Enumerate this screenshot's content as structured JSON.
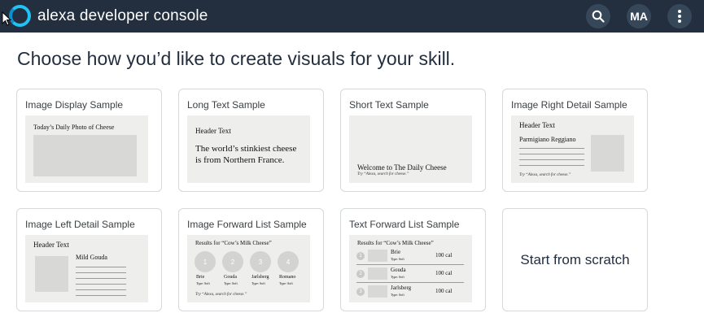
{
  "header": {
    "brand": "alexa developer console",
    "avatar_initials": "MA",
    "icons": [
      "alexa-logo",
      "search-icon",
      "more-vertical-icon"
    ]
  },
  "page": {
    "title": "Choose how you’d like to create visuals for your skill."
  },
  "cards": {
    "image_display": {
      "title": "Image Display Sample",
      "preview_header": "Today’s Daily Photo of Cheese"
    },
    "long_text": {
      "title": "Long Text Sample",
      "preview_header": "Header Text",
      "preview_body": "The world’s stinkiest cheese is from Northern France."
    },
    "short_text": {
      "title": "Short Text Sample",
      "preview_primary": "Welcome to The Daily Cheese",
      "preview_hint": "Try “Alexa, search for cheese.”"
    },
    "image_right_detail": {
      "title": "Image Right Detail Sample",
      "preview_header": "Header Text",
      "preview_subtitle": "Parmigiano Reggiano",
      "preview_hint": "Try “Alexa, search for cheese.”"
    },
    "image_left_detail": {
      "title": "Image Left Detail Sample",
      "preview_header": "Header Text",
      "preview_subtitle": "Mild Gouda"
    },
    "image_forward_list": {
      "title": "Image Forward List Sample",
      "preview_header": "Results for “Cow’s Milk Cheese”",
      "items": [
        {
          "num": "1",
          "name": "Brie",
          "type": "Type: Soft"
        },
        {
          "num": "2",
          "name": "Gouda",
          "type": "Type: Soft"
        },
        {
          "num": "3",
          "name": "Jarlsberg",
          "type": "Type: Soft"
        },
        {
          "num": "4",
          "name": "Romano",
          "type": "Type: Soft"
        }
      ],
      "preview_hint": "Try “Alexa, search for cheese.”"
    },
    "text_forward_list": {
      "title": "Text Forward List Sample",
      "preview_header": "Results for “Cow’s Milk Cheese”",
      "items": [
        {
          "num": "1",
          "name": "Brie",
          "type": "Type: Soft",
          "cal": "100 cal"
        },
        {
          "num": "2",
          "name": "Gouda",
          "type": "Type: Soft",
          "cal": "100 cal"
        },
        {
          "num": "3",
          "name": "Jarlsberg",
          "type": "Type: Soft",
          "cal": "100 cal"
        }
      ]
    },
    "scratch": {
      "label": "Start from scratch"
    }
  }
}
